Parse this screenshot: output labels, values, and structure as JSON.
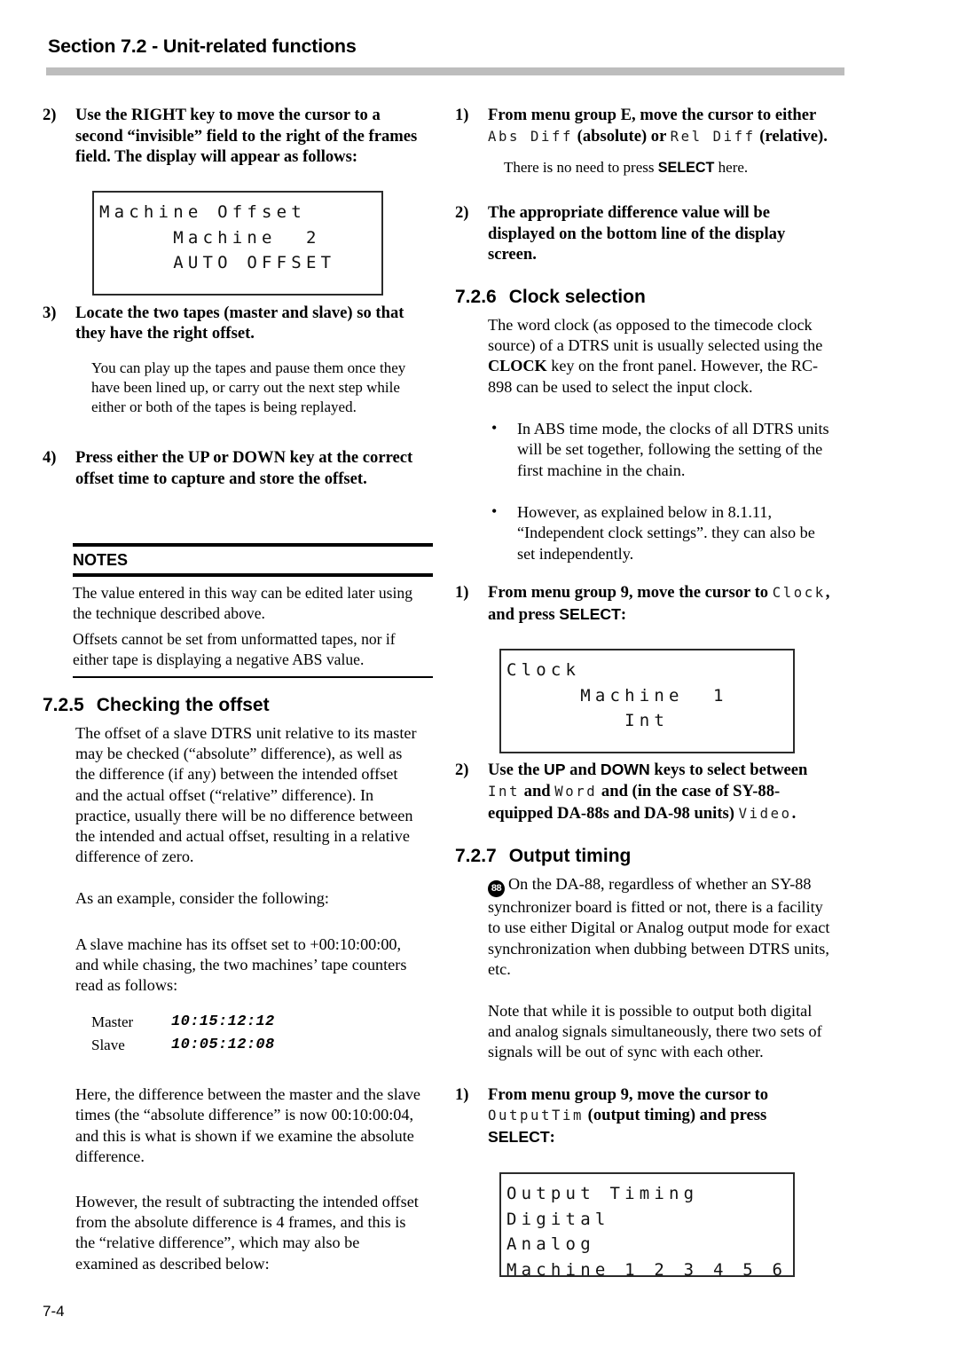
{
  "header": {
    "title": "Section 7.2 - Unit-related functions"
  },
  "folio": "7-4",
  "left_column": {
    "step2": {
      "num": "2)",
      "text_a": "Use the ",
      "key_right": "RIGHT",
      "text_b": " key to move the cursor to a second “invisible” field to the right of the frames field. The display will appear as follows:"
    },
    "lcd_machine_offset": {
      "name": "machine-offset-display",
      "lines": [
        "Machine Offset",
        "     Machine  2",
        "     AUTO OFFSET",
        ""
      ]
    },
    "step3": {
      "num": "3)",
      "text": "Locate the two tapes (master and slave) so that they have the right offset.",
      "note": "You can play up the tapes and pause them once they have been lined up, or carry out the next step while either or both of the tapes is being replayed."
    },
    "step4": {
      "num": "4)",
      "text": "Press either the UP or DOWN key at the correct offset time to capture and store the offset."
    },
    "notes": {
      "label": "NOTES",
      "items": [
        "The value entered in this way can be edited later using the technique described above.",
        "Offsets cannot be set from unformatted tapes, nor if either tape is displaying a negative ABS value."
      ]
    },
    "section_725": {
      "number": "7.2.5",
      "title": "Checking the offset",
      "p1": "The offset of a slave DTRS unit relative to its master may be checked (“absolute” difference), as well as the difference (if any) between the intended offset and the actual offset (“relative” difference). In practice, usually there will be no difference between the intended and actual offset, resulting in a relative difference of zero.",
      "p2": "As an example, consider the following:",
      "p3": "A slave machine has its offset set to +00:10:00:00, and while chasing, the two machines’ tape counters read as follows:",
      "readings": [
        {
          "label": "Master",
          "value": "10:15:12:12"
        },
        {
          "label": "Slave",
          "value": "10:05:12:08"
        }
      ],
      "p4": "Here, the difference between the master and the slave times (the “absolute difference” is now 00:10:00:04, and this is what is shown if we examine the absolute difference.",
      "p5": "However, the result of subtracting the intended offset from the absolute difference is 4 frames, and this is the “relative difference”, which may also be examined as described below:"
    }
  },
  "right_column": {
    "step1_diff": {
      "num": "1)",
      "text_a": "From menu group E, move the cursor to either ",
      "token_abs": "Abs Diff",
      "text_b": " (absolute) or ",
      "token_rel": "Rel Diff",
      "text_c": " (relative).",
      "sub": {
        "text_a": "There is no need to press ",
        "key_select": "SELECT",
        "text_b": " here."
      }
    },
    "step2_diff": {
      "num": "2)",
      "text": "The appropriate difference value will be displayed on the bottom line of the display screen."
    },
    "section_726": {
      "number": "7.2.6",
      "title": "Clock selection",
      "p1_a": "The word clock (as opposed to the timecode clock source) of a DTRS unit is usually selected using the ",
      "p1_key": "CLOCK",
      "p1_b": " key on the front panel. However, the RC-898 can be used to select the input clock.",
      "bullets": [
        "In ABS time mode, the clocks of all DTRS units will be set together, following the setting of the first machine in the chain.",
        "However, as explained below in 8.1.11, “Independent clock settings”. they can also be set independently."
      ],
      "step1": {
        "num": "1)",
        "text_a": "From menu group 9, move the cursor to ",
        "token": "Clock",
        "text_b": ", and press ",
        "key_select": "SELECT",
        "text_c": ":"
      },
      "lcd_clock": {
        "name": "clock-display",
        "lines": [
          "Clock",
          "     Machine  1",
          "",
          "        Int"
        ]
      },
      "step2": {
        "num": "2)",
        "text_a": "Use the ",
        "key_up": "UP",
        "text_b": " and ",
        "key_down": "DOWN",
        "text_c": " keys to select between ",
        "token_int": "Int",
        "text_d": " and ",
        "token_word": "Word",
        "text_e": " and (in the case of SY-88-equipped DA-88s and DA-98 units) ",
        "token_video": "Video",
        "text_f": "."
      }
    },
    "section_727": {
      "number": "7.2.7",
      "title": "Output timing",
      "badge": "88",
      "p1": "On the DA-88, regardless of whether an SY-88 synchronizer board is fitted or not, there is a facility to use either Digital or Analog output mode for exact synchronization when dubbing between DTRS units, etc.",
      "p2": "Note that while it is possible to output both digital and analog signals simultaneously, there two sets of signals will be out of sync with each other.",
      "step1": {
        "num": "1)",
        "text_a": "From menu group 9, move the cursor to ",
        "token": "OutputTim",
        "text_b": " (output timing) and press ",
        "key_select": "SELECT",
        "text_c": ":"
      },
      "lcd_output": {
        "name": "output-timing-display",
        "lines": [
          "Output Timing",
          "Digital",
          "Analog",
          "Machine 1 2 3 4 5 6"
        ]
      }
    }
  },
  "colors": {
    "header_rule": "#bdbdbd",
    "ink": "#000000",
    "lcd_border": "#2b2b2b"
  }
}
